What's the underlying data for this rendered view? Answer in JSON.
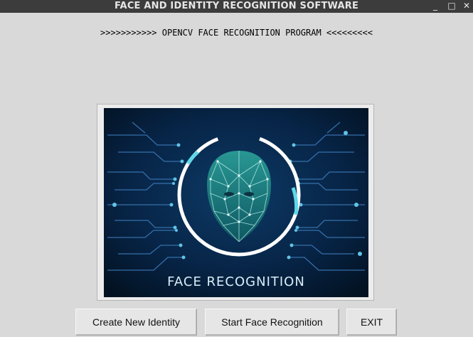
{
  "window": {
    "title": "FACE AND IDENTITY RECOGNITION SOFTWARE",
    "controls": [
      "minimize",
      "maximize",
      "close"
    ],
    "minimize_glyph": "_",
    "maximize_glyph": "□",
    "close_glyph": "✕"
  },
  "banner": ">>>>>>>>>>> OPENCV FACE RECOGNITION PROGRAM <<<<<<<<<",
  "image": {
    "caption": "FACE RECOGNITION",
    "accent_color": "#5fd8e8",
    "background_color": "#061b33"
  },
  "buttons": {
    "create": "Create New Identity",
    "start": "Start Face Recognition",
    "exit": "EXIT"
  }
}
